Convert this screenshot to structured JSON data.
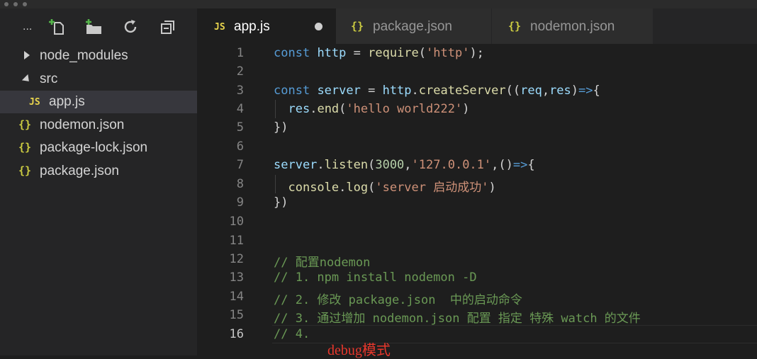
{
  "toolbar": {
    "more_label": "..."
  },
  "explorer": {
    "items": [
      {
        "label": "node_modules"
      },
      {
        "label": "src"
      },
      {
        "label": "app.js",
        "badge": "JS"
      },
      {
        "label": "nodemon.json",
        "badge": "{}"
      },
      {
        "label": "package-lock.json",
        "badge": "{}"
      },
      {
        "label": "package.json",
        "badge": "{}"
      }
    ]
  },
  "tabs": [
    {
      "label": "app.js",
      "badge": "JS",
      "active": true,
      "dirty": true
    },
    {
      "label": "package.json",
      "badge": "{}"
    },
    {
      "label": "nodemon.json",
      "badge": "{}"
    }
  ],
  "editor": {
    "active_line": 16,
    "lines": [
      {
        "n": "1"
      },
      {
        "n": "2"
      },
      {
        "n": "3"
      },
      {
        "n": "4"
      },
      {
        "n": "5"
      },
      {
        "n": "6"
      },
      {
        "n": "7"
      },
      {
        "n": "8"
      },
      {
        "n": "9"
      },
      {
        "n": "10"
      },
      {
        "n": "11"
      },
      {
        "n": "12"
      },
      {
        "n": "13"
      },
      {
        "n": "14"
      },
      {
        "n": "15"
      },
      {
        "n": "16"
      }
    ],
    "tokens": {
      "l1": {
        "kw": "const",
        "v": "http",
        "eq": " = ",
        "fn": "require",
        "p1": "(",
        "s": "'http'",
        "p2": ");"
      },
      "l3": {
        "kw": "const",
        "v": "server",
        "eq": " = ",
        "v2": "http",
        "dot": ".",
        "fn": "createServer",
        "p1": "((",
        "a1": "req",
        "c": ",",
        "a2": "res",
        "p2": ")",
        "ar": "=>",
        "br": "{"
      },
      "l4": {
        "v": "res",
        "dot": ".",
        "fn": "end",
        "p1": "(",
        "s": "'hello world222'",
        "p2": ")"
      },
      "l5": {
        "t": "})"
      },
      "l7": {
        "v": "server",
        "dot": ".",
        "fn": "listen",
        "p1": "(",
        "num": "3000",
        "c": ",",
        "s": "'127.0.0.1'",
        "c2": ",",
        "p2": "()",
        "ar": "=>",
        "br": "{"
      },
      "l8": {
        "v": "console",
        "dot": ".",
        "fn": "log",
        "p1": "(",
        "s": "'server 启动成功'",
        "p2": ")"
      },
      "l9": {
        "t": "})"
      },
      "l12": {
        "t": "// 配置nodemon"
      },
      "l13": {
        "t": "// 1. npm install nodemon -D"
      },
      "l14": {
        "t": "// 2. 修改 package.json  中的启动命令"
      },
      "l15": {
        "t": "// 3. 通过增加 nodemon.json 配置 指定 特殊 watch 的文件"
      },
      "l16": {
        "t": "// 4."
      }
    }
  },
  "annotation": {
    "text": "debug模式"
  },
  "colors": {
    "keyword": "#569cd6",
    "variable": "#9cdcfe",
    "function": "#dcdcaa",
    "string": "#ce9178",
    "number": "#b5cea8",
    "comment": "#6a9955",
    "annotation": "#e8372c"
  }
}
